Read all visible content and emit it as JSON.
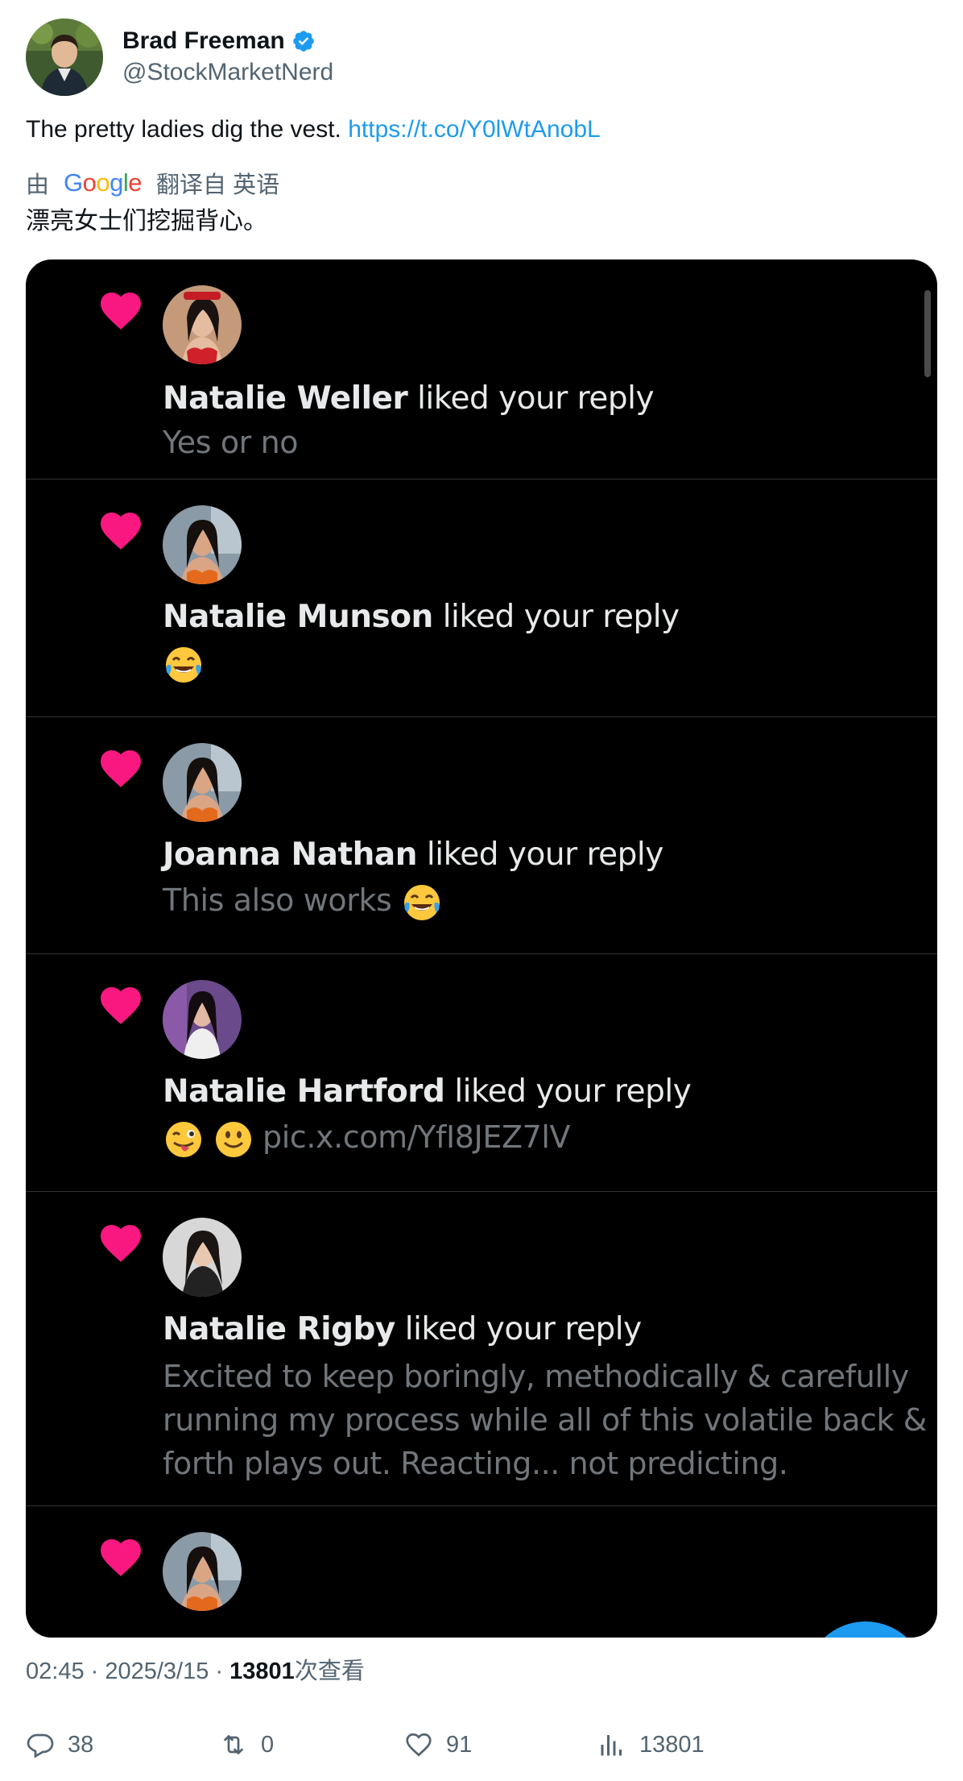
{
  "author": {
    "display_name": "Brad Freeman",
    "handle": "@StockMarketNerd",
    "verified": true
  },
  "tweet": {
    "text": "The pretty ladies dig the vest. ",
    "link": "https://t.co/Y0lWtAnobL"
  },
  "translation": {
    "by_label": "由",
    "provider": "Google",
    "translated_from": "翻译自 英语",
    "text": "漂亮女士们挖掘背心。"
  },
  "media": {
    "notifications": [
      {
        "name": "Natalie Weller",
        "action": " liked your reply",
        "text": "Yes or no",
        "emojis": []
      },
      {
        "name": "Natalie Munson",
        "action": " liked your reply",
        "text": "",
        "emojis": [
          "laughing-tears"
        ]
      },
      {
        "name": "Joanna Nathan",
        "action": " liked your reply",
        "text": "This also works ",
        "emojis": [
          "laughing-tears"
        ]
      },
      {
        "name": "Natalie Hartford",
        "action": " liked your reply",
        "text": "pic.x.com/YfI8JEZ7lV",
        "emojis": [
          "winking-tongue",
          "slight-smile"
        ]
      },
      {
        "name": "Natalie Rigby",
        "action": " liked your reply",
        "text_lines": [
          "Excited to keep boringly, methodically & carefully",
          "running my process while all of this volatile back &",
          "forth plays out. Reacting... not predicting."
        ]
      },
      {
        "name": "",
        "action": "",
        "text": ""
      }
    ],
    "accent_heart": "#f91880"
  },
  "meta": {
    "time": "02:45",
    "date": "2025/3/15",
    "views": "13801",
    "views_label": "次查看"
  },
  "actions": {
    "replies": "38",
    "retweets": "0",
    "likes": "91",
    "views": "13801"
  },
  "colors": {
    "link": "#1d9bf0",
    "muted": "#536471",
    "media_bg": "#000000"
  }
}
